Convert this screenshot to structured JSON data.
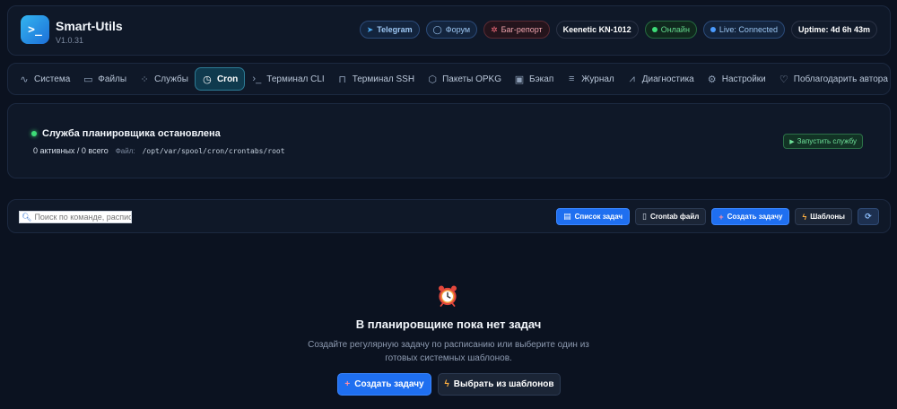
{
  "header": {
    "logo_glyph": ">_",
    "title": "Smart-Utils",
    "version": "V1.0.31",
    "badges": {
      "telegram": "Telegram",
      "forum": "Форум",
      "bug_report": "Баг-репорт",
      "device": "Keenetic KN-1012",
      "online": "Онлайн",
      "live": "Live: Connected",
      "uptime": "Uptime: 4d 6h 43m"
    }
  },
  "nav": {
    "tabs": [
      {
        "label": "Система",
        "icon": "activity-icon"
      },
      {
        "label": "Файлы",
        "icon": "folder-icon"
      },
      {
        "label": "Службы",
        "icon": "spinner-icon"
      },
      {
        "label": "Cron",
        "icon": "clock-icon",
        "active": true
      },
      {
        "label": "Терминал CLI",
        "icon": "terminal-icon"
      },
      {
        "label": "Терминал SSH",
        "icon": "lock-icon"
      },
      {
        "label": "Пакеты OPKG",
        "icon": "package-icon"
      },
      {
        "label": "Бэкап",
        "icon": "save-icon"
      },
      {
        "label": "Журнал",
        "icon": "list-icon"
      },
      {
        "label": "Диагностика",
        "icon": "pulse-icon"
      },
      {
        "label": "Настройки",
        "icon": "gear-icon"
      },
      {
        "label": "Поблагодарить автора",
        "icon": "heart-icon"
      }
    ]
  },
  "status": {
    "title": "Служба планировщика остановлена",
    "counts": "0 активных / 0 всего",
    "file_label": "Файл:",
    "file_path": "/opt/var/spool/cron/crontabs/root",
    "start_button": "Запустить службу"
  },
  "toolbar": {
    "search_placeholder": "Поиск по команде, расписанию",
    "task_list": "Список задач",
    "crontab_file": "Crontab файл",
    "create_task": "Создать задачу",
    "templates": "Шаблоны"
  },
  "empty": {
    "title": "В планировщике пока нет задач",
    "description": "Создайте регулярную задачу по расписанию или выберите один из готовых системных шаблонов.",
    "create_button": "Создать задачу",
    "templates_button": "Выбрать из шаблонов"
  },
  "colors": {
    "background": "#0b1220",
    "card": "#0f1828",
    "accent": "#1f6ff0",
    "active_tab": "#0f3a4e",
    "online": "#3ddc77"
  }
}
